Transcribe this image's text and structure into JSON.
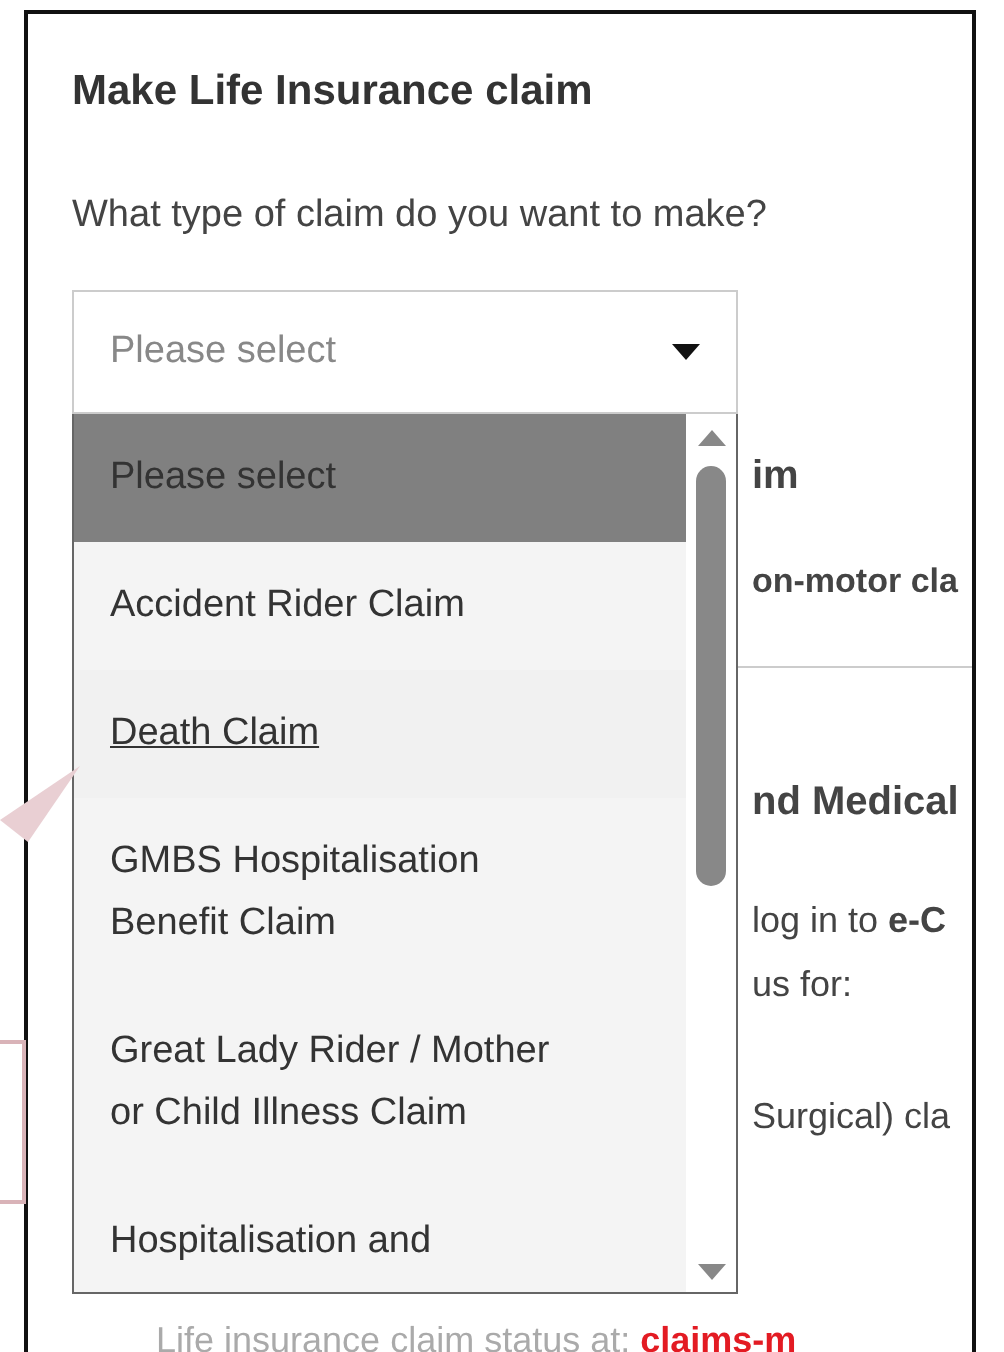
{
  "panel": {
    "title": "Make Life Insurance claim",
    "question": "What type of claim do you want to make?"
  },
  "select": {
    "placeholder": "Please select",
    "expanded": true,
    "options": [
      {
        "label": "Please select",
        "selected": true,
        "hovered": false
      },
      {
        "label": "Accident Rider Claim",
        "selected": false,
        "hovered": false
      },
      {
        "label": "Death Claim",
        "selected": false,
        "hovered": true
      },
      {
        "label": "GMBS Hospitalisation Benefit Claim",
        "selected": false,
        "hovered": false
      },
      {
        "label": "Great Lady Rider / Mother or Child Illness Claim",
        "selected": false,
        "hovered": false
      },
      {
        "label": "Hospitalisation and",
        "selected": false,
        "hovered": false
      }
    ]
  },
  "background_content": [
    {
      "kind": "heading",
      "text": "im"
    },
    {
      "kind": "strong",
      "text": "on-motor cla"
    },
    {
      "kind": "divider"
    },
    {
      "kind": "heading",
      "text": "nd Medical"
    },
    {
      "kind": "text",
      "text": "log in to **e-C**"
    },
    {
      "kind": "text",
      "text": "us for:"
    },
    {
      "kind": "text",
      "text": "Surgical) cla"
    }
  ],
  "status_line": {
    "text": "Life insurance claim status at: ",
    "link": "claims-m"
  }
}
